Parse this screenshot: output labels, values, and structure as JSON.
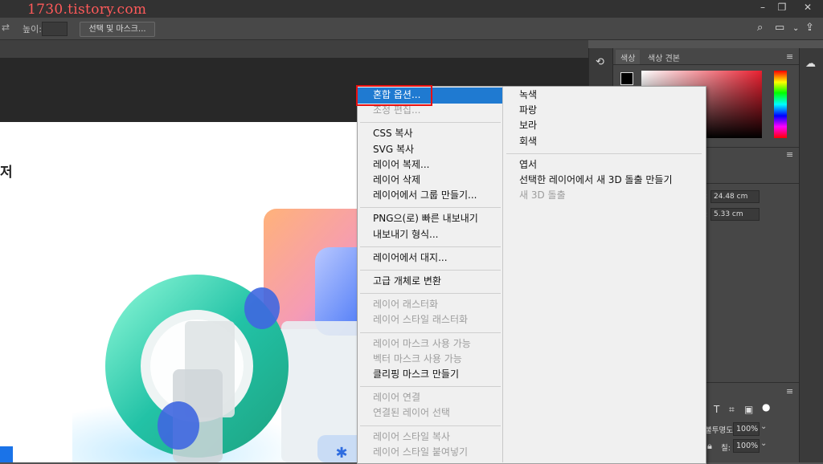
{
  "watermark": "1730.tistory.com",
  "window": {
    "minimize": "–",
    "restore": "❐",
    "close": "✕"
  },
  "options_bar": {
    "height_label": "높이:",
    "select_mask_label": "선택 및 마스크..."
  },
  "document": {
    "visible_text": "저"
  },
  "panels": {
    "tabs": [
      "색상",
      "색상 견본"
    ],
    "width_value": "24.48 cm",
    "height_value": "5.33 cm",
    "opacity_label": "불투명도:",
    "opacity_value": "100%",
    "fill_label": "칠:",
    "fill_value": "100%"
  },
  "context_menu": {
    "left_column": [
      {
        "label": "혼합 옵션...",
        "enabled": true,
        "highlighted": true
      },
      {
        "label": "조정 편집...",
        "enabled": false
      },
      {
        "separator": true
      },
      {
        "label": "CSS 복사",
        "enabled": true
      },
      {
        "label": "SVG 복사",
        "enabled": true
      },
      {
        "label": "레이어 복제...",
        "enabled": true
      },
      {
        "label": "레이어 삭제",
        "enabled": true
      },
      {
        "label": "레이어에서 그룹 만들기...",
        "enabled": true
      },
      {
        "separator": true
      },
      {
        "label": "PNG으(로) 빠른 내보내기",
        "enabled": true
      },
      {
        "label": "내보내기 형식...",
        "enabled": true
      },
      {
        "separator": true
      },
      {
        "label": "레이어에서 대지...",
        "enabled": true
      },
      {
        "separator": true
      },
      {
        "label": "고급 개체로 변환",
        "enabled": true
      },
      {
        "separator": true
      },
      {
        "label": "레이어 래스터화",
        "enabled": false
      },
      {
        "label": "레이어 스타일 래스터화",
        "enabled": false
      },
      {
        "separator": true
      },
      {
        "label": "레이어 마스크 사용 가능",
        "enabled": false
      },
      {
        "label": "벡터 마스크 사용 가능",
        "enabled": false
      },
      {
        "label": "클리핑 마스크 만들기",
        "enabled": true
      },
      {
        "separator": true
      },
      {
        "label": "레이어 연결",
        "enabled": false
      },
      {
        "label": "연결된 레이어 선택",
        "enabled": false
      },
      {
        "separator": true
      },
      {
        "label": "레이어 스타일 복사",
        "enabled": false
      },
      {
        "label": "레이어 스타일 붙여넣기",
        "enabled": false
      }
    ],
    "right_column": [
      {
        "label": "녹색",
        "enabled": true
      },
      {
        "label": "파랑",
        "enabled": true
      },
      {
        "label": "보라",
        "enabled": true
      },
      {
        "label": "회색",
        "enabled": true
      },
      {
        "separator": true
      },
      {
        "label": "엽서",
        "enabled": true
      },
      {
        "label": "선택한 레이어에서 새 3D 돌출 만들기",
        "enabled": true
      },
      {
        "label": "새 3D 돌출",
        "enabled": false
      }
    ]
  },
  "colors": {
    "menu_highlight": "#1f7ad1",
    "annotation_box": "#e81010",
    "watermark": "#ff5a5a"
  }
}
